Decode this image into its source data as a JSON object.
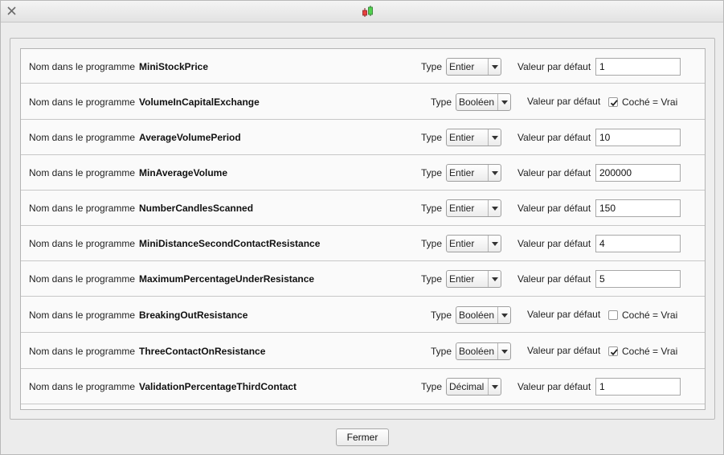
{
  "window": {
    "close_icon": "close-icon",
    "app_icon": "candlestick-chart-icon"
  },
  "labels": {
    "name_prefix": "Nom dans le programme",
    "type": "Type",
    "default": "Valeur par défaut",
    "checked_true": "Coché = Vrai"
  },
  "rows": [
    {
      "name": "MiniStockPrice",
      "type": "Entier",
      "value": "1"
    },
    {
      "name": "VolumeInCapitalExchange",
      "type": "Booléen",
      "checked": true
    },
    {
      "name": "AverageVolumePeriod",
      "type": "Entier",
      "value": "10"
    },
    {
      "name": "MinAverageVolume",
      "type": "Entier",
      "value": "200000"
    },
    {
      "name": "NumberCandlesScanned",
      "type": "Entier",
      "value": "150"
    },
    {
      "name": "MiniDistanceSecondContactResistance",
      "type": "Entier",
      "value": "4"
    },
    {
      "name": "MaximumPercentageUnderResistance",
      "type": "Entier",
      "value": "5"
    },
    {
      "name": "BreakingOutResistance",
      "type": "Booléen",
      "checked": false
    },
    {
      "name": "ThreeContactOnResistance",
      "type": "Booléen",
      "checked": true
    },
    {
      "name": "ValidationPercentageThirdContact",
      "type": "Décimal",
      "value": "1"
    }
  ],
  "footer": {
    "close_label": "Fermer"
  }
}
